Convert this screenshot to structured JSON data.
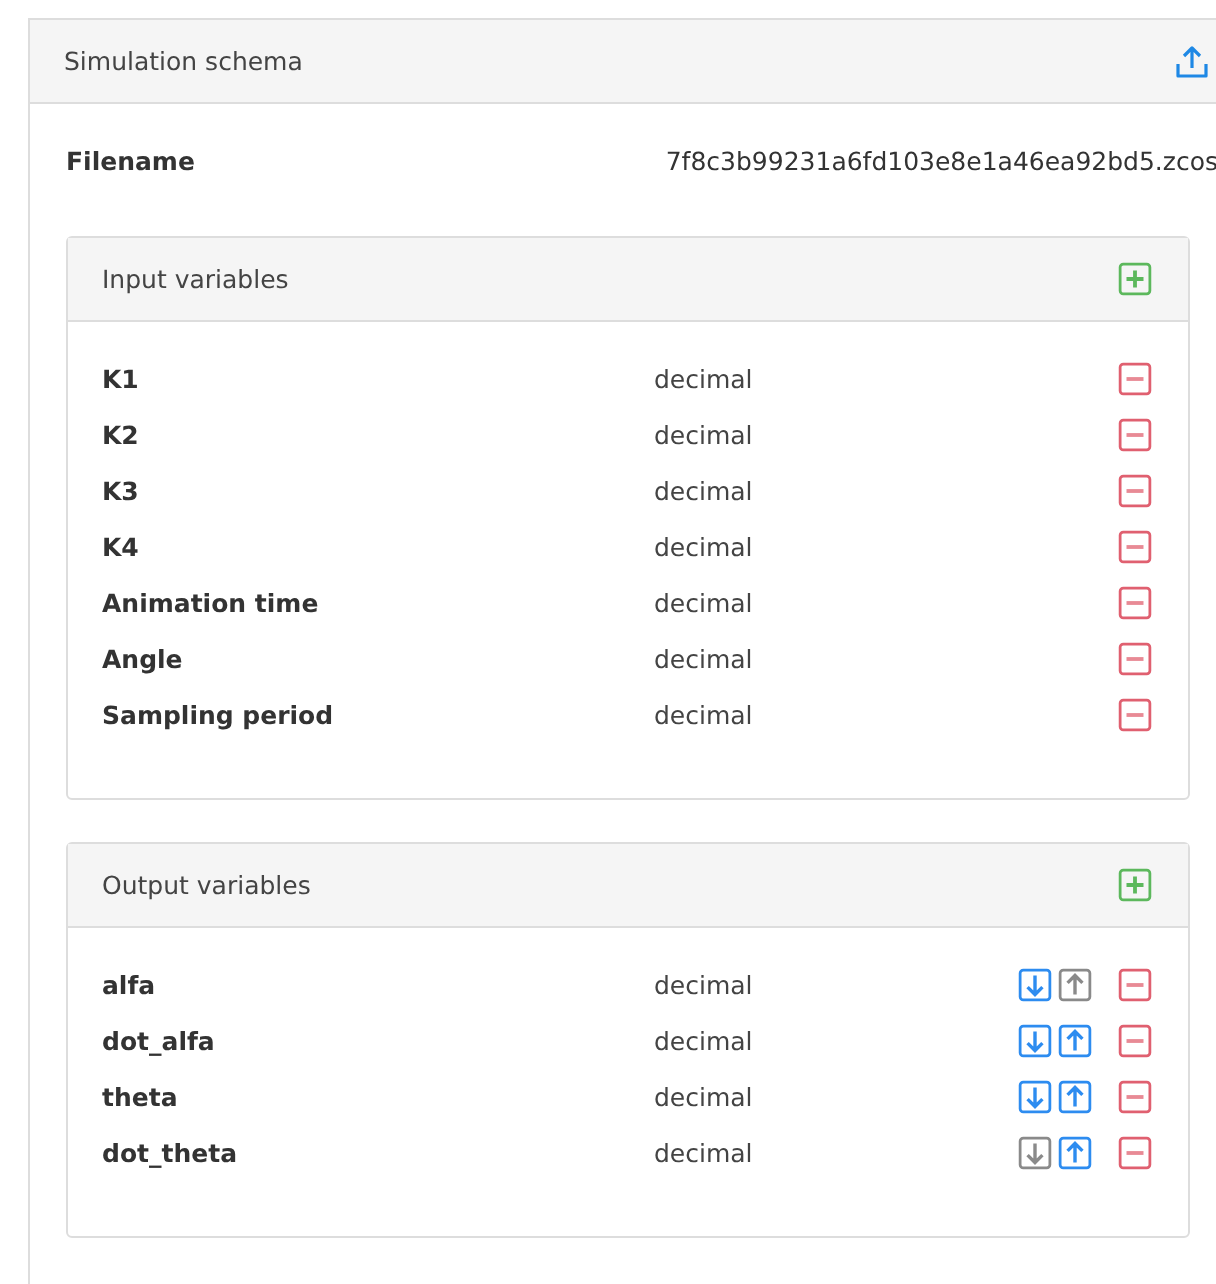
{
  "panel": {
    "title": "Simulation schema"
  },
  "filename": {
    "label": "Filename",
    "value": "7f8c3b99231a6fd103e8e1a46ea92bd5.zcos"
  },
  "input_variables": {
    "title": "Input variables",
    "rows": [
      {
        "name": "K1",
        "type": "decimal"
      },
      {
        "name": "K2",
        "type": "decimal"
      },
      {
        "name": "K3",
        "type": "decimal"
      },
      {
        "name": "K4",
        "type": "decimal"
      },
      {
        "name": "Animation time",
        "type": "decimal"
      },
      {
        "name": "Angle",
        "type": "decimal"
      },
      {
        "name": "Sampling period",
        "type": "decimal"
      }
    ]
  },
  "output_variables": {
    "title": "Output variables",
    "rows": [
      {
        "name": "alfa",
        "type": "decimal",
        "down_disabled": false,
        "up_disabled": true
      },
      {
        "name": "dot_alfa",
        "type": "decimal",
        "down_disabled": false,
        "up_disabled": false
      },
      {
        "name": "theta",
        "type": "decimal",
        "down_disabled": false,
        "up_disabled": false
      },
      {
        "name": "dot_theta",
        "type": "decimal",
        "down_disabled": true,
        "up_disabled": false
      }
    ]
  }
}
